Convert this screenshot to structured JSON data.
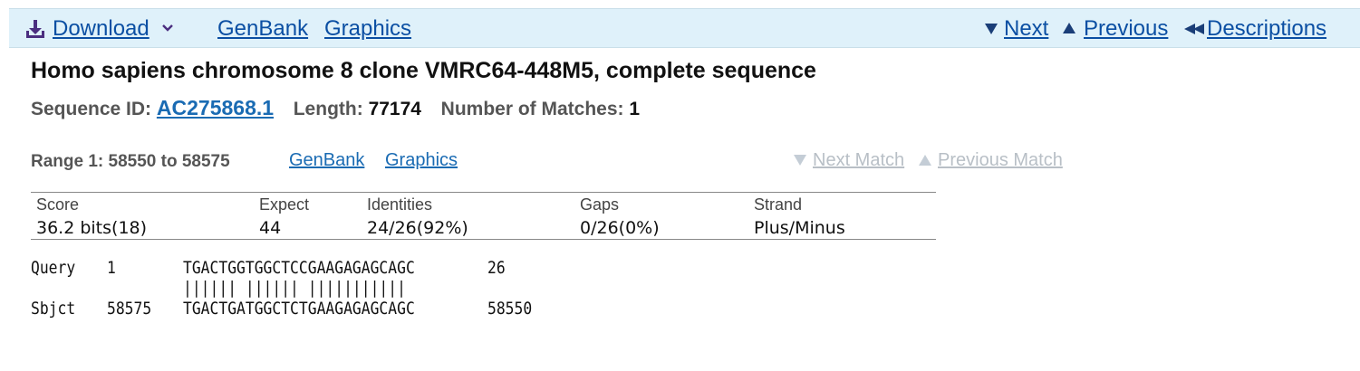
{
  "toolbar": {
    "download": "Download",
    "genbank": "GenBank",
    "graphics": "Graphics",
    "next": "Next",
    "previous": "Previous",
    "descriptions": "Descriptions"
  },
  "title": "Homo sapiens chromosome 8 clone VMRC64-448M5, complete sequence",
  "sequence": {
    "id_label": "Sequence ID:",
    "id_value": "AC275868.1",
    "length_label": "Length:",
    "length_value": "77174",
    "matches_label": "Number of Matches:",
    "matches_value": "1"
  },
  "range": {
    "label": "Range 1: 58550 to 58575",
    "genbank": "GenBank",
    "graphics": "Graphics",
    "next_match": "Next Match",
    "previous_match": "Previous Match"
  },
  "stats": {
    "headers": [
      "Score",
      "Expect",
      "Identities",
      "Gaps",
      "Strand"
    ],
    "values": [
      "36.2 bits(18)",
      "44",
      "24/26(92%)",
      "0/26(0%)",
      "Plus/Minus"
    ]
  },
  "alignment": {
    "query_label": "Query",
    "query_start": "1",
    "query_seq": "TGACTGGTGGCTCCGAAGAGAGCAGC",
    "query_end": "26",
    "match_line": "|||||| |||||| |||||||||||",
    "sbjct_label": "Sbjct",
    "sbjct_start": "58575",
    "sbjct_seq": "TGACTGATGGCTCTGAAGAGAGCAGC",
    "sbjct_end": "58550"
  },
  "colors": {
    "toolbar_bg": "#dff1fa",
    "link": "#0b4fa3",
    "disabled_link": "#b8bfc6"
  }
}
